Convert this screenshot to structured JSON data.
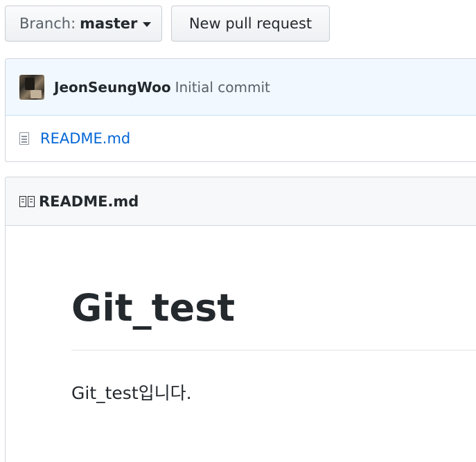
{
  "toolbar": {
    "branch_prefix": "Branch:",
    "branch_value": "master",
    "new_pr_label": "New pull request"
  },
  "commit": {
    "author": "JeonSeungWoo",
    "message": "Initial commit"
  },
  "files": [
    {
      "name": "README.md"
    }
  ],
  "readme": {
    "header": "README.md",
    "title": "Git_test",
    "paragraph": "Git_test입니다."
  },
  "colors": {
    "link": "#0366d6",
    "commit_bar_bg": "#f1f8ff",
    "header_bg": "#f6f8fa"
  }
}
